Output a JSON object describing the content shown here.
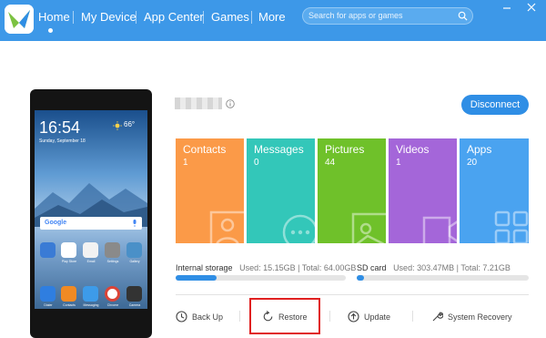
{
  "nav": {
    "items": [
      {
        "label": "Home",
        "active": true
      },
      {
        "label": "My Device"
      },
      {
        "label": "App Center"
      },
      {
        "label": "Games"
      },
      {
        "label": "More"
      }
    ],
    "search_placeholder": "Search for apps or games"
  },
  "phone": {
    "time": "16:54",
    "date": "Sunday, September 18",
    "temperature": "66°",
    "search_brand": "Google",
    "apps": [
      {
        "label": "",
        "color": "#3a7bd5"
      },
      {
        "label": "Play Store",
        "color": "#ffffff"
      },
      {
        "label": "Email",
        "color": "#f2f2f2"
      },
      {
        "label": "Settings",
        "color": "#8a8a8a"
      },
      {
        "label": "Gallery",
        "color": "#4a90c8"
      },
      {
        "label": "Dialer",
        "color": "#2f7ee0"
      },
      {
        "label": "Contacts",
        "color": "#f08a24"
      },
      {
        "label": "Messaging",
        "color": "#3d9be9"
      },
      {
        "label": "Chrome",
        "color": "#ffffff"
      },
      {
        "label": "Camera",
        "color": "#333333"
      }
    ]
  },
  "device": {
    "disconnect_label": "Disconnect"
  },
  "categories": [
    {
      "label": "Contacts",
      "count": "1",
      "color": "#fb9a48",
      "icon": "person-icon"
    },
    {
      "label": "Messages",
      "count": "0",
      "color": "#33c7b9",
      "icon": "chat-bubble-icon"
    },
    {
      "label": "Pictures",
      "count": "44",
      "color": "#6fc12a",
      "icon": "picture-icon"
    },
    {
      "label": "Videos",
      "count": "1",
      "color": "#a466d9",
      "icon": "video-camera-icon"
    },
    {
      "label": "Apps",
      "count": "20",
      "color": "#4aa3f0",
      "icon": "grid-icon"
    }
  ],
  "storage": {
    "internal": {
      "label": "Internal storage",
      "used": "Used: 15.15GB",
      "total": "Total: 64.00GB",
      "fraction": 0.24
    },
    "sd": {
      "label": "SD card",
      "used": "Used: 303.47MB",
      "total": "Total: 7.21GB",
      "fraction": 0.04
    },
    "separator": "|"
  },
  "actions": [
    {
      "label": "Back Up",
      "icon": "clock-icon"
    },
    {
      "label": "Restore",
      "icon": "restore-icon",
      "highlighted": true
    },
    {
      "label": "Update",
      "icon": "upload-arrow-icon"
    },
    {
      "label": "System Recovery",
      "icon": "wrench-icon"
    }
  ]
}
